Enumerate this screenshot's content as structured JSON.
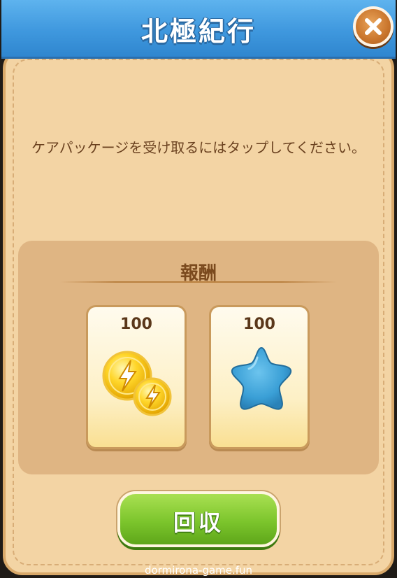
{
  "header": {
    "title": "北極紀行",
    "close_icon": "close-icon"
  },
  "dialog": {
    "message": "ケアパッケージを受け取るにはタップしてください。"
  },
  "rewards": {
    "title": "報酬",
    "items": [
      {
        "count": "100",
        "icon": "energy-coins-icon"
      },
      {
        "count": "100",
        "icon": "blue-star-icon"
      }
    ]
  },
  "actions": {
    "collect_label": "回収"
  },
  "watermark": "dormirona-game.fun",
  "colors": {
    "title_bar": "#3f98de",
    "panel": "#f3d4a4",
    "collect_button": "#7cc52c",
    "close_button": "#c9752c"
  }
}
